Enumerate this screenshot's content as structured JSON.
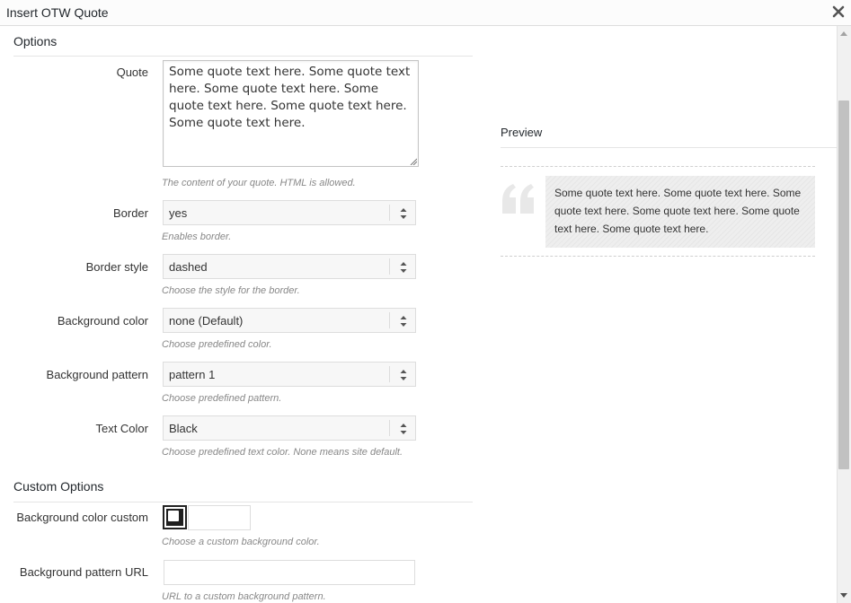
{
  "dialog": {
    "title": "Insert OTW Quote"
  },
  "options": {
    "section_title": "Options",
    "quote": {
      "label": "Quote",
      "value": "Some quote text here. Some quote text here. Some quote text here. Some quote text here. Some quote text here. Some quote text here.",
      "description": "The content of your quote. HTML is allowed."
    },
    "border": {
      "label": "Border",
      "value": "yes",
      "description": "Enables border."
    },
    "border_style": {
      "label": "Border style",
      "value": "dashed",
      "description": "Choose the style for the border."
    },
    "background_color": {
      "label": "Background color",
      "value": "none (Default)",
      "description": "Choose predefined color."
    },
    "background_pattern": {
      "label": "Background pattern",
      "value": "pattern 1",
      "description": "Choose predefined pattern."
    },
    "text_color": {
      "label": "Text Color",
      "value": "Black",
      "description": "Choose predefined text color. None means site default."
    }
  },
  "custom_options": {
    "section_title": "Custom Options",
    "background_color_custom": {
      "label": "Background color custom",
      "value": "",
      "description": "Choose a custom background color."
    },
    "background_pattern_url": {
      "label": "Background pattern URL",
      "value": "",
      "description": "URL to a custom background pattern."
    }
  },
  "preview": {
    "title": "Preview",
    "quote_text": "Some quote text here. Some quote text here. Some quote text here. Some quote text here. Some quote text here. Some quote text here."
  },
  "icons": {
    "close": "close-icon",
    "select_arrows": "select-arrows-icon",
    "quote_mark": "quote-mark-icon",
    "color_picker": "color-picker-icon"
  },
  "colors": {
    "preview_background": "#eeeeee",
    "quote_mark": "#e5e5e5",
    "swatch_border": "#222222"
  }
}
